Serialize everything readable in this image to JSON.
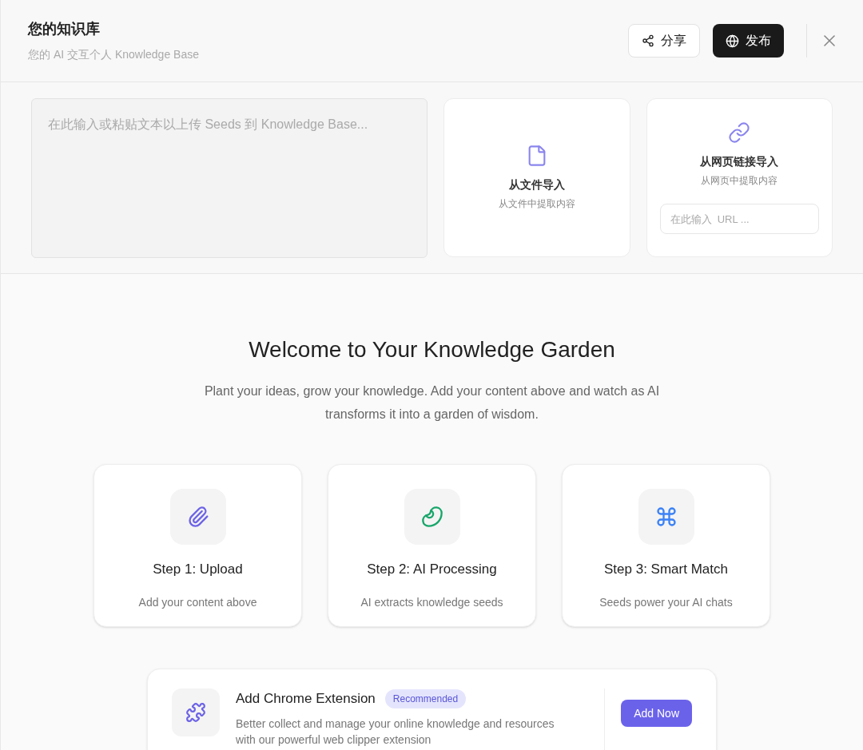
{
  "header": {
    "title": "您的知识库",
    "subtitle": "您的 AI 交互个人 Knowledge Base",
    "buttons": [
      {
        "kind": "share",
        "label": "分享"
      },
      {
        "kind": "publish",
        "label": "发布"
      },
      {
        "kind": "close"
      }
    ]
  },
  "upload": {
    "text_placeholder": "在此输入或粘贴文本以上传 Seeds 到 Knowledge Base...",
    "cards": [
      {
        "kind": "file",
        "title": "从文件导入",
        "subtitle": "从文件中提取内容"
      },
      {
        "kind": "link",
        "title": "从网页链接导入",
        "subtitle": "从网页中提取内容",
        "placeholder": "在此输入  URL ..."
      }
    ]
  },
  "welcome": {
    "title": "Welcome to Your Knowledge Garden",
    "description": "Plant your ideas, grow your knowledge. Add your content above and watch as AI transforms it into a garden of wisdom.",
    "steps": [
      {
        "kind": "upload",
        "title": "Step 1: Upload",
        "description": "Add your content above"
      },
      {
        "kind": "processing",
        "title": "Step 2: AI Processing",
        "description": "AI extracts knowledge seeds"
      },
      {
        "kind": "match",
        "title": "Step 3: Smart Match",
        "description": "Seeds power your AI chats"
      }
    ]
  },
  "extension": {
    "title": "Add Chrome Extension",
    "badge": "Recommended",
    "description": "Better collect and manage your online knowledge and resources with our powerful web clipper extension",
    "button": "Add Now"
  }
}
